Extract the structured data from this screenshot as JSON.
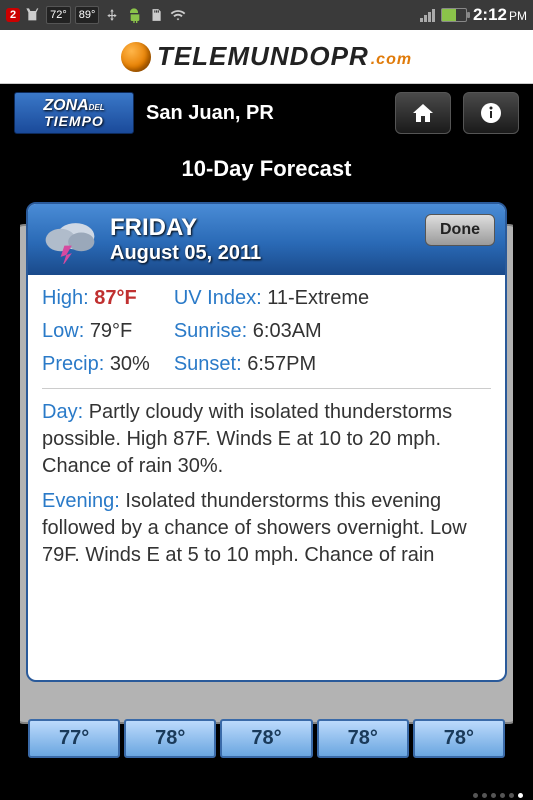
{
  "statusbar": {
    "notif_count": "2",
    "temp1": "72°",
    "temp2": "89°",
    "time": "2:12",
    "ampm": "PM"
  },
  "logo": {
    "text": "TELEMUNDOPR",
    "suffix": ".com"
  },
  "zona": {
    "line1": "ZONA",
    "line2": "DEL",
    "line3": "TIEMPO"
  },
  "location": "San Juan, PR",
  "page_title": "10-Day Forecast",
  "card": {
    "day_name": "FRIDAY",
    "date": "August 05, 2011",
    "done": "Done",
    "high_label": "High:",
    "high_val": "87°F",
    "low_label": "Low:",
    "low_val": "79°F",
    "precip_label": "Precip:",
    "precip_val": "30%",
    "uv_label": "UV Index:",
    "uv_val": "11-Extreme",
    "sunrise_label": "Sunrise:",
    "sunrise_val": "6:03AM",
    "sunset_label": "Sunset:",
    "sunset_val": "6:57PM",
    "day_label": "Day:",
    "day_text": "Partly cloudy with isolated thunderstorms possible. High 87F. Winds E at 10 to 20 mph. Chance of rain 30%.",
    "evening_label": "Evening:",
    "evening_text": "Isolated thunderstorms this evening followed by a chance of showers overnight. Low 79F. Winds E at 5 to 10 mph. Chance of rain"
  },
  "strip": [
    "77°",
    "78°",
    "78°",
    "78°",
    "78°"
  ]
}
